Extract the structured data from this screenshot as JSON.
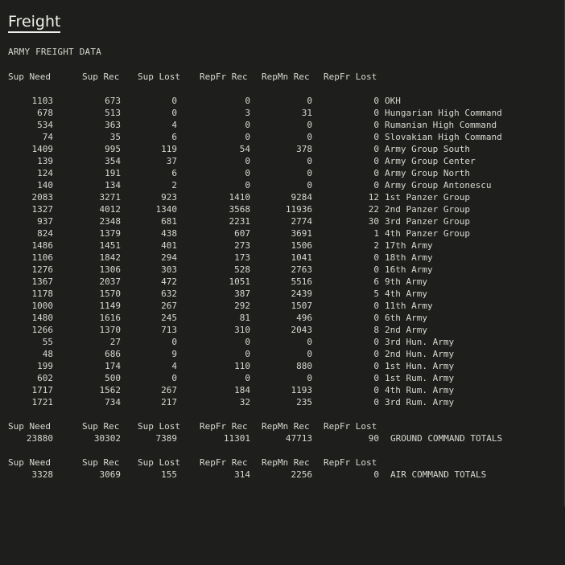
{
  "title": "Freight",
  "subtitle": "ARMY FREIGHT DATA",
  "columns": [
    "Sup Need",
    "Sup Rec",
    "Sup Lost",
    "RepFr Rec",
    "RepMn Rec",
    "RepFr Lost"
  ],
  "rows": [
    [
      "1103",
      "673",
      "0",
      "0",
      "0",
      "0",
      "OKH"
    ],
    [
      "678",
      "513",
      "0",
      "3",
      "31",
      "0",
      "Hungarian High Command"
    ],
    [
      "534",
      "363",
      "4",
      "0",
      "0",
      "0",
      "Rumanian High Command"
    ],
    [
      "74",
      "35",
      "6",
      "0",
      "0",
      "0",
      "Slovakian High Command"
    ],
    [
      "1409",
      "995",
      "119",
      "54",
      "378",
      "0",
      "Army Group South"
    ],
    [
      "139",
      "354",
      "37",
      "0",
      "0",
      "0",
      "Army Group Center"
    ],
    [
      "124",
      "191",
      "6",
      "0",
      "0",
      "0",
      "Army Group North"
    ],
    [
      "140",
      "134",
      "2",
      "0",
      "0",
      "0",
      "Army Group Antonescu"
    ],
    [
      "2083",
      "3271",
      "923",
      "1410",
      "9284",
      "12",
      "1st Panzer Group"
    ],
    [
      "1327",
      "4012",
      "1340",
      "3568",
      "11936",
      "22",
      "2nd Panzer Group"
    ],
    [
      "937",
      "2348",
      "681",
      "2231",
      "2774",
      "30",
      "3rd Panzer Group"
    ],
    [
      "824",
      "1379",
      "438",
      "607",
      "3691",
      "1",
      "4th Panzer Group"
    ],
    [
      "1486",
      "1451",
      "401",
      "273",
      "1506",
      "2",
      "17th Army"
    ],
    [
      "1106",
      "1842",
      "294",
      "173",
      "1041",
      "0",
      "18th Army"
    ],
    [
      "1276",
      "1306",
      "303",
      "528",
      "2763",
      "0",
      "16th Army"
    ],
    [
      "1367",
      "2037",
      "472",
      "1051",
      "5516",
      "6",
      "9th Army"
    ],
    [
      "1178",
      "1570",
      "632",
      "387",
      "2439",
      "5",
      "4th Army"
    ],
    [
      "1000",
      "1149",
      "267",
      "292",
      "1507",
      "0",
      "11th Army"
    ],
    [
      "1480",
      "1616",
      "245",
      "81",
      "496",
      "0",
      "6th Army"
    ],
    [
      "1266",
      "1370",
      "713",
      "310",
      "2043",
      "8",
      "2nd Army"
    ],
    [
      "55",
      "27",
      "0",
      "0",
      "0",
      "0",
      "3rd Hun. Army"
    ],
    [
      "48",
      "686",
      "9",
      "0",
      "0",
      "0",
      "2nd Hun. Army"
    ],
    [
      "199",
      "174",
      "4",
      "110",
      "880",
      "0",
      "1st Hun. Army"
    ],
    [
      "602",
      "500",
      "0",
      "0",
      "0",
      "0",
      "1st Rum. Army"
    ],
    [
      "1717",
      "1562",
      "267",
      "184",
      "1193",
      "0",
      "4th Rum. Army"
    ],
    [
      "1721",
      "734",
      "217",
      "32",
      "235",
      "0",
      "3rd Rum. Army"
    ]
  ],
  "ground_totals": [
    "23880",
    "30302",
    "7389",
    "11301",
    "47713",
    "90",
    "GROUND COMMAND TOTALS"
  ],
  "air_totals": [
    "3328",
    "3069",
    "155",
    "314",
    "2256",
    "0",
    "AIR COMMAND TOTALS"
  ]
}
